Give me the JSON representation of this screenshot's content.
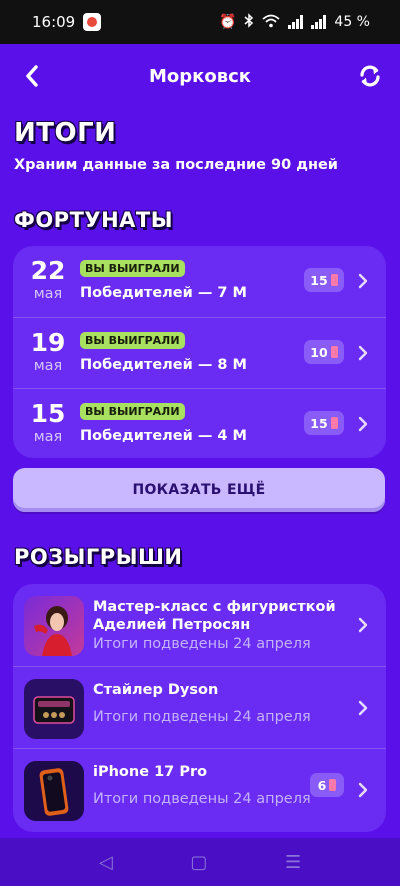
{
  "status_bar": {
    "time": "16:09",
    "battery": "45 %"
  },
  "header": {
    "title": "Морковск",
    "back_icon": "chevron-left-icon",
    "refresh_icon": "refresh-icon"
  },
  "results": {
    "heading": "ИТОГИ",
    "subtitle": "Храним данные за последние 90 дней"
  },
  "fortunates": {
    "heading": "ФОРТУНАТЫ",
    "items": [
      {
        "day": "22",
        "month": "мая",
        "badge": "ВЫ ВЫИГРАЛИ",
        "winners": "Победителей — 7 М",
        "tickets": "15"
      },
      {
        "day": "19",
        "month": "мая",
        "badge": "ВЫ ВЫИГРАЛИ",
        "winners": "Победителей — 8 М",
        "tickets": "10"
      },
      {
        "day": "15",
        "month": "мая",
        "badge": "ВЫ ВЫИГРАЛИ",
        "winners": "Победителей — 4 М",
        "tickets": "15"
      }
    ],
    "show_more_label": "ПОКАЗАТЬ ЕЩЁ"
  },
  "draws": {
    "heading": "РОЗЫГРЫШИ",
    "items": [
      {
        "title": "Мастер-класс с фигуристкой Аделией Петросян",
        "subtitle": "Итоги подведены 24 апреля"
      },
      {
        "title": "Стайлер Dyson",
        "subtitle": "Итоги подведены 24 апреля"
      },
      {
        "title": "iPhone 17 Pro",
        "subtitle": "Итоги подведены 24 апреля",
        "tickets": "6"
      }
    ]
  },
  "colors": {
    "background": "#5a10e8",
    "card": "#6a2bf2",
    "badge": "#a8e05f",
    "button": "#c9b8ff"
  }
}
